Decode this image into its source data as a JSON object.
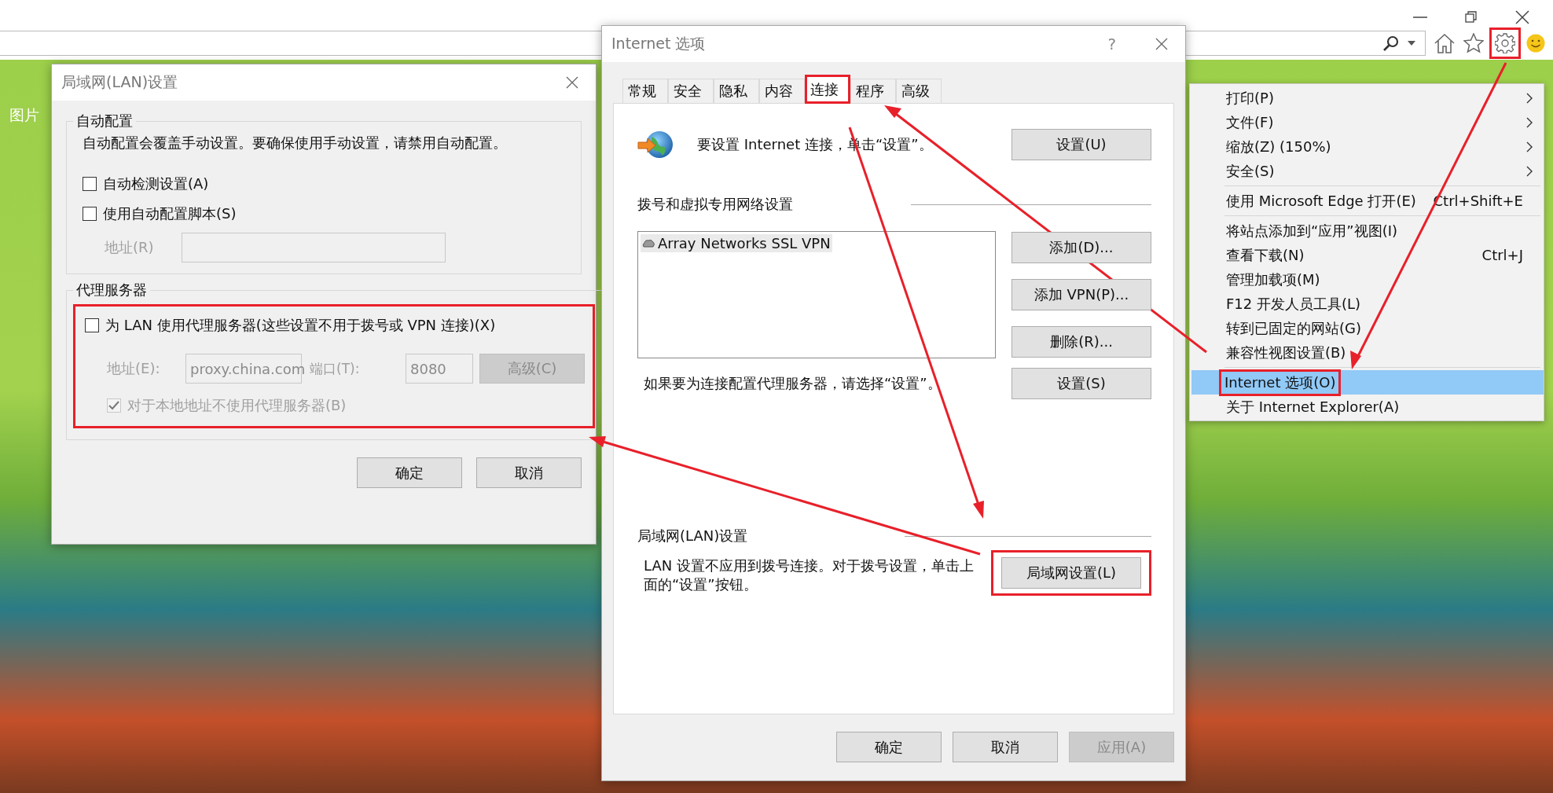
{
  "browser": {
    "side_text": "图片",
    "settings_button": {
      "highlighted": true
    }
  },
  "lan_dialog": {
    "title": "局域网(LAN)设置",
    "auto_config": {
      "heading": "自动配置",
      "note": "自动配置会覆盖手动设置。要确保使用手动设置，请禁用自动配置。",
      "options": [
        {
          "label": "自动检测设置(A)",
          "checked": false
        },
        {
          "label": "使用自动配置脚本(S)",
          "checked": false
        }
      ],
      "address": {
        "label": "地址(R)",
        "disabled": true
      }
    },
    "proxy": {
      "heading": "代理服务器",
      "highlighted": true,
      "use_proxy": {
        "label": "为 LAN 使用代理服务器(这些设置不用于拨号或 VPN 连接)(X)",
        "checked": false
      },
      "fields_disabled": true,
      "address_label": "地址(E):",
      "address_value": "proxy.china.com",
      "port_label": "端口(T):",
      "port_value": "8080",
      "advanced_button": {
        "label": "高级(C)",
        "disabled": true
      },
      "bypass_local": {
        "label": "对于本地地址不使用代理服务器(B)",
        "checked": true,
        "disabled": true
      }
    },
    "buttons": [
      {
        "label": "确定",
        "disabled": false
      },
      {
        "label": "取消",
        "disabled": false
      }
    ]
  },
  "options_dialog": {
    "title": "Internet 选项",
    "help": "?",
    "tabs": [
      {
        "label": "常规",
        "selected": false,
        "highlighted": false
      },
      {
        "label": "安全",
        "selected": false,
        "highlighted": false
      },
      {
        "label": "隐私",
        "selected": false,
        "highlighted": false
      },
      {
        "label": "内容",
        "selected": false,
        "highlighted": false
      },
      {
        "label": "连接",
        "selected": true,
        "highlighted": true
      },
      {
        "label": "程序",
        "selected": false,
        "highlighted": false
      },
      {
        "label": "高级",
        "selected": false,
        "highlighted": false
      }
    ],
    "intro": {
      "text": "要设置 Internet 连接，单击“设置”。",
      "button": "设置(U)"
    },
    "dialup": {
      "heading": "拨号和虚拟专用网络设置",
      "connections": [
        {
          "label": "Array Networks SSL VPN",
          "selected": true
        }
      ],
      "buttons": [
        "添加(D)...",
        "添加 VPN(P)...",
        "删除(R)..."
      ],
      "note": "如果要为连接配置代理服务器，请选择“设置”。",
      "settings_button": "设置(S)"
    },
    "lan": {
      "heading": "局域网(LAN)设置",
      "note": "LAN 设置不应用到拨号连接。对于拨号设置，单击上面的“设置”按钮。",
      "button": {
        "label": "局域网设置(L)",
        "highlighted": true
      }
    },
    "buttons": [
      {
        "label": "确定",
        "disabled": false
      },
      {
        "label": "取消",
        "disabled": false
      },
      {
        "label": "应用(A)",
        "disabled": true
      }
    ]
  },
  "tools_menu": {
    "groups": [
      [
        {
          "label": "打印(P)",
          "has_submenu": true,
          "selected": false,
          "highlighted": false
        },
        {
          "label": "文件(F)",
          "has_submenu": true,
          "selected": false,
          "highlighted": false
        },
        {
          "label": "缩放(Z) (150%)",
          "has_submenu": true,
          "selected": false,
          "highlighted": false
        },
        {
          "label": "安全(S)",
          "has_submenu": true,
          "selected": false,
          "highlighted": false
        }
      ],
      [
        {
          "label": "使用 Microsoft Edge 打开(E)",
          "shortcut": "Ctrl+Shift+E",
          "has_submenu": false,
          "selected": false,
          "highlighted": false
        }
      ],
      [
        {
          "label": "将站点添加到“应用”视图(I)",
          "has_submenu": false,
          "selected": false,
          "highlighted": false
        },
        {
          "label": "查看下载(N)",
          "shortcut": "Ctrl+J",
          "has_submenu": false,
          "selected": false,
          "highlighted": false
        },
        {
          "label": "管理加载项(M)",
          "has_submenu": false,
          "selected": false,
          "highlighted": false
        },
        {
          "label": "F12 开发人员工具(L)",
          "has_submenu": false,
          "selected": false,
          "highlighted": false
        },
        {
          "label": "转到已固定的网站(G)",
          "has_submenu": false,
          "selected": false,
          "highlighted": false
        },
        {
          "label": "兼容性视图设置(B)",
          "has_submenu": false,
          "selected": false,
          "highlighted": false
        }
      ],
      [
        {
          "label": "Internet 选项(O)",
          "has_submenu": false,
          "selected": true,
          "highlighted": true
        },
        {
          "label": "关于 Internet Explorer(A)",
          "has_submenu": false,
          "selected": false,
          "highlighted": false
        }
      ]
    ]
  }
}
